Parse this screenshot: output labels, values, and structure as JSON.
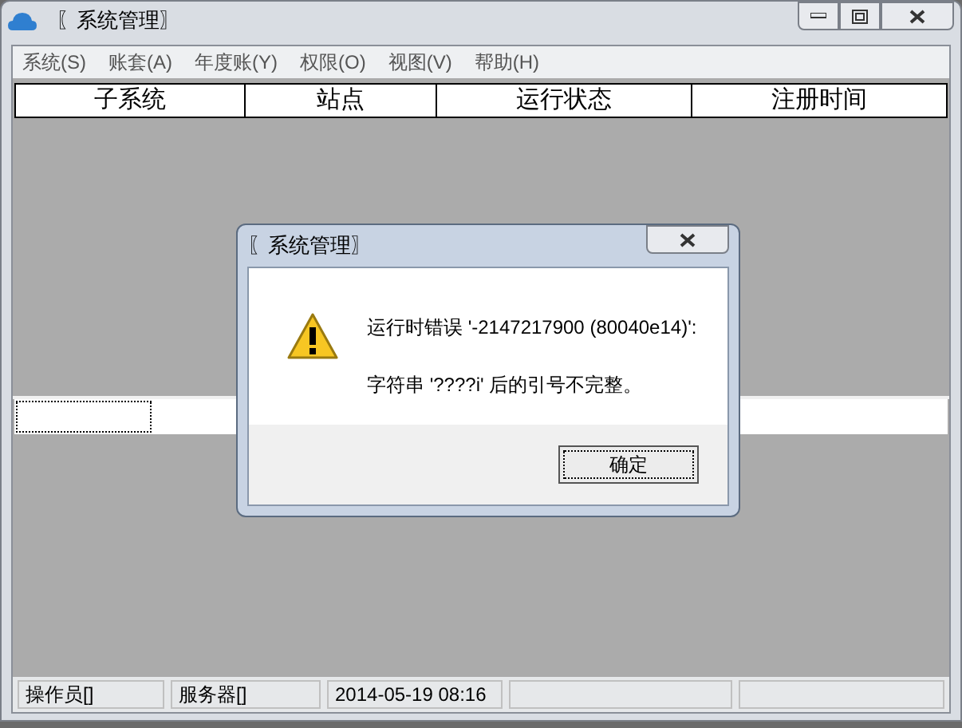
{
  "window": {
    "title": "〖系统管理〗"
  },
  "menu": [
    {
      "label": "系统(S)"
    },
    {
      "label": "账套(A)"
    },
    {
      "label": "年度账(Y)"
    },
    {
      "label": "权限(O)"
    },
    {
      "label": "视图(V)"
    },
    {
      "label": "帮助(H)"
    }
  ],
  "table": {
    "columns": [
      "子系统",
      "站点",
      "运行状态",
      "注册时间"
    ]
  },
  "dialog": {
    "title": "〖系统管理〗",
    "message_lines": [
      "运行时错误 '-2147217900 (80040e14)':",
      "字符串 '????i' 后的引号不完整。"
    ],
    "button": "确定"
  },
  "status_bar": [
    "操作员[]",
    "服务器[]",
    "2014-05-19 08:16"
  ]
}
